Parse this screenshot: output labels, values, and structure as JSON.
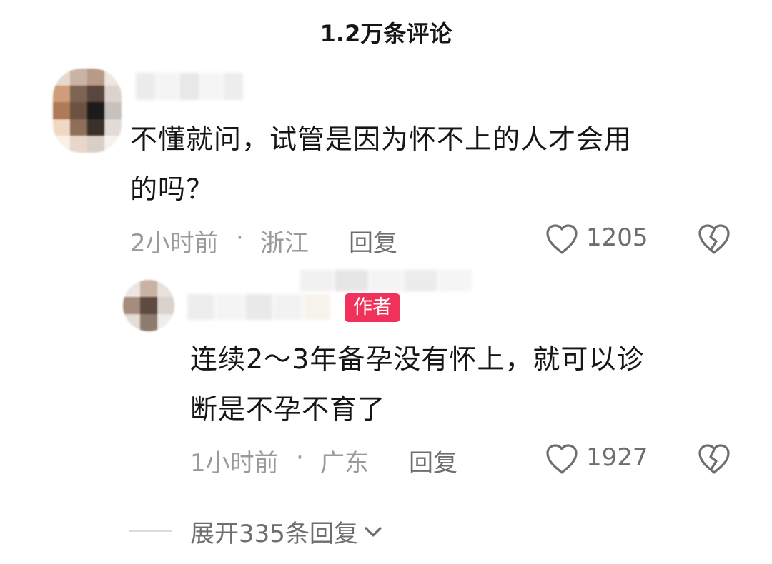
{
  "header": {
    "title": "1.2万条评论"
  },
  "comment": {
    "text_line1": "不懂就问，试管是因为怀不上的人才会用",
    "text_line2": "的吗？",
    "time": "2小时前",
    "separator": "·",
    "location": "浙江",
    "reply_label": "回复",
    "likes": "1205",
    "avatar_colors": [
      "#e6d8cf",
      "#c9b3a4",
      "#b89a88",
      "#eee6df",
      "#cf9d7b",
      "#7d6453",
      "#5a463c",
      "#dcd3cc",
      "#b07a58",
      "#6d5242",
      "#1d1b1a",
      "#c7c1bd",
      "#f0d9c4",
      "#8e6f5a",
      "#3a302a",
      "#e2dbd6",
      "#fbf0e6",
      "#e7d6c9",
      "#d8cfc8",
      "#f5f2ef"
    ]
  },
  "reply": {
    "badge": "作者",
    "text_line1": "连续2～3年备孕没有怀上，就可以诊",
    "text_line2": "断是不孕不育了",
    "time": "1小时前",
    "separator": "·",
    "location": "广东",
    "reply_label": "回复",
    "likes": "1927",
    "avatar_colors": [
      "#ece6e1",
      "#c9b2a2",
      "#e8e1dc",
      "#a58c7d",
      "#5e4a40",
      "#d9d2cd",
      "#e3dcd7",
      "#8f7a6e",
      "#f0ece9"
    ]
  },
  "expand": {
    "label": "展开335条回复"
  }
}
